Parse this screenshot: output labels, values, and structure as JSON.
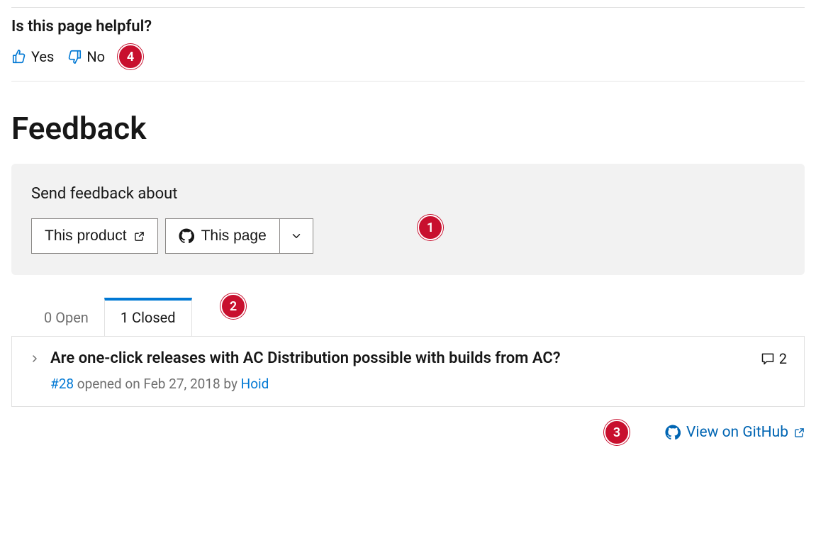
{
  "helpful": {
    "title": "Is this page helpful?",
    "yes_label": "Yes",
    "no_label": "No"
  },
  "feedback": {
    "heading": "Feedback",
    "send_label": "Send feedback about",
    "product_button": "This product",
    "page_button": "This page"
  },
  "tabs": {
    "open": "0 Open",
    "closed": "1 Closed"
  },
  "issue": {
    "title": "Are one-click releases with AC Distribution possible with builds from AC?",
    "comment_count": "2",
    "number": "#28",
    "opened_text": " opened on Feb 27, 2018 by ",
    "author": "Hoid"
  },
  "footer": {
    "view_github": "View on GitHub"
  },
  "callouts": {
    "c1": "1",
    "c2": "2",
    "c3": "3",
    "c4": "4"
  }
}
